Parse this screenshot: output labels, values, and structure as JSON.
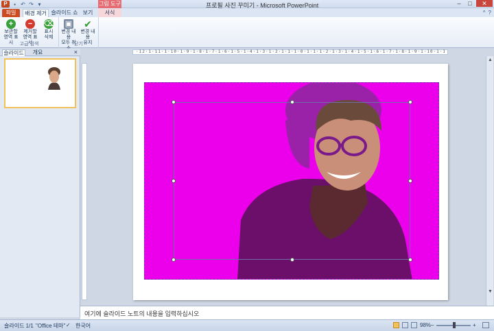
{
  "window": {
    "title": "프로필 사진 꾸미기 - Microsoft PowerPoint",
    "tool_context": "그림 도구",
    "buttons": [
      "–",
      "□",
      "✕"
    ]
  },
  "qat": {
    "app_letter": "P",
    "icons": [
      "save-icon",
      "undo-icon",
      "redo-icon",
      "customize-icon"
    ]
  },
  "tabs": {
    "file": "파일",
    "active": "배경 제거",
    "slideshow": "슬라이드 쇼",
    "view": "보기",
    "format": "서식",
    "help_icons": [
      "^",
      "?"
    ]
  },
  "ribbon": {
    "refine_group": "고급 검색",
    "close_group": "닫기",
    "buttons": [
      {
        "label_line1": "보관할",
        "label_line2": "영역 표시",
        "icon": "plus-circle-icon",
        "color": "#3aa13a"
      },
      {
        "label_line1": "제거할",
        "label_line2": "영역 표시",
        "icon": "minus-circle-icon",
        "color": "#d43b2f"
      },
      {
        "label_line1": "표시",
        "label_line2": "삭제",
        "icon": "eraser-icon",
        "color": "#3aa13a"
      },
      {
        "label_line1": "변경 내용",
        "label_line2": "모두 취소",
        "icon": "discard-icon",
        "color": "#7a8aa0"
      },
      {
        "label_line1": "변경 내용",
        "label_line2": "유지",
        "icon": "checkmark-icon",
        "color": "#2e9b2e"
      }
    ]
  },
  "left_panel": {
    "tabs": [
      "슬라이드",
      "개요"
    ],
    "close": "×",
    "slide_number": "1"
  },
  "ruler": {
    "horizontal": "·12·1·11·1·10·1·9·1·8·1·7·1·6·1·5·1·4·1·3·1·2·1·1·1·0·1·1·1·2·1·3·1·4·1·5·1·6·1·7·1·8·1·9·1·10·1·11·1·12·"
  },
  "notes": {
    "placeholder": "여기에 슬라이드 노트의 내용을 입력하십시오"
  },
  "status": {
    "slide": "슬라이드 1/1",
    "theme": "\"Office 테마\"",
    "language": "한국어",
    "zoom": "98%",
    "zoom_minus": "–",
    "zoom_plus": "+"
  },
  "colors": {
    "removal_overlay": "#ec00ec",
    "accent": "#cc4a1f"
  }
}
